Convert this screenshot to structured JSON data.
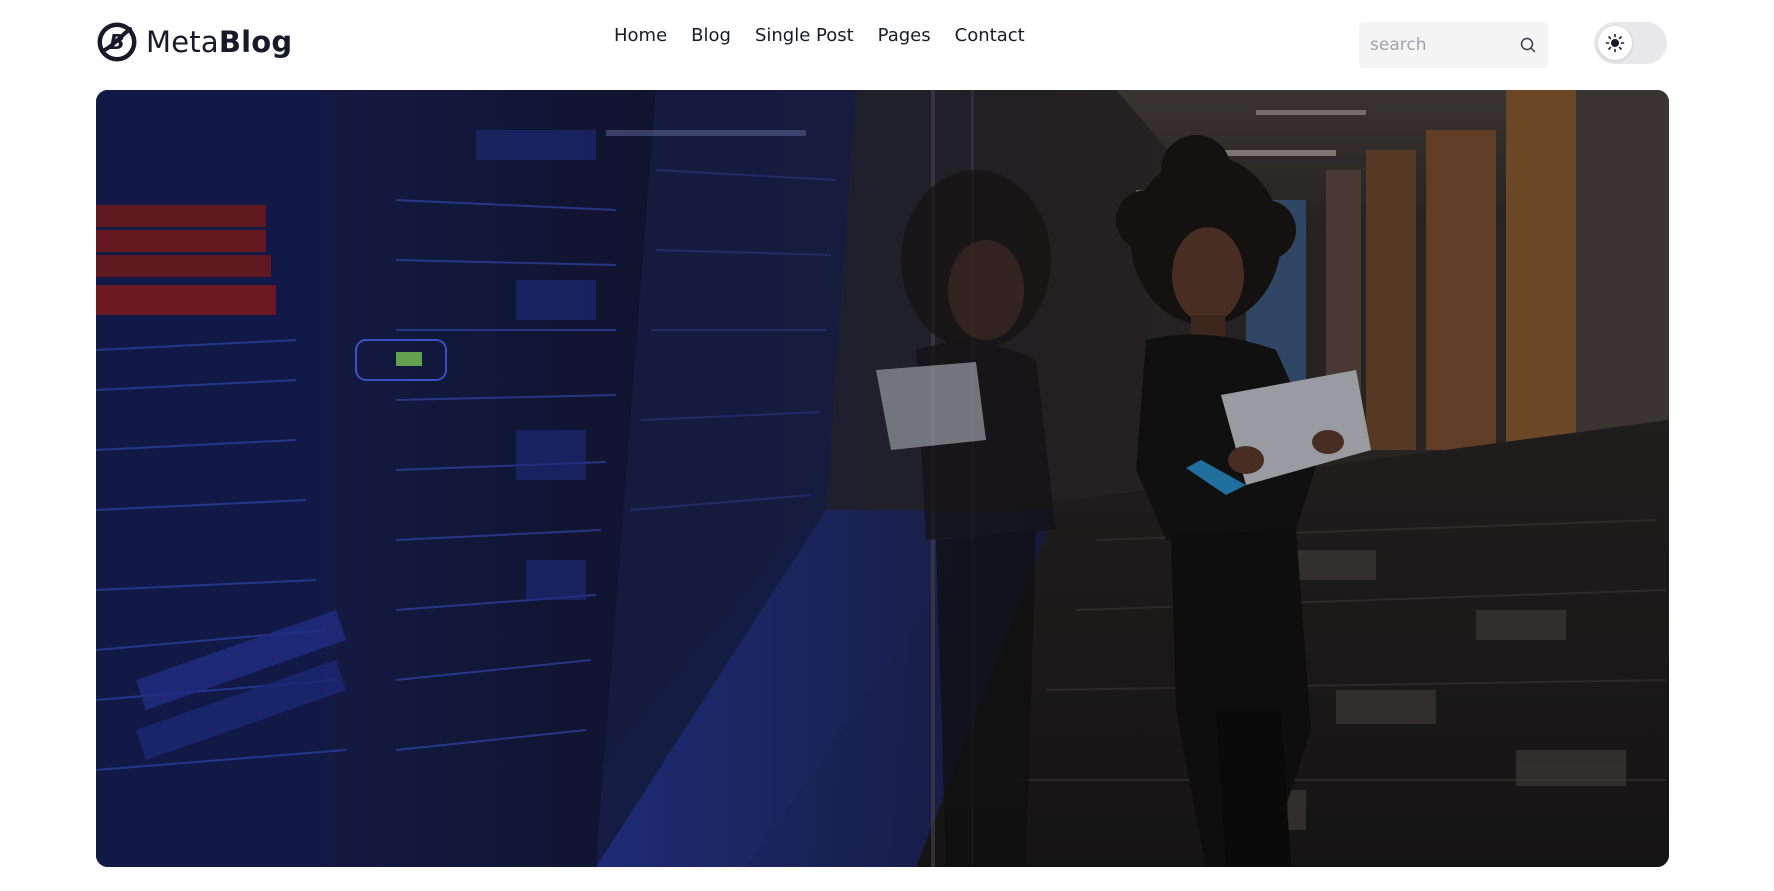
{
  "brand": {
    "name_light": "Meta",
    "name_bold": "Blog"
  },
  "nav": {
    "items": [
      {
        "label": "Home"
      },
      {
        "label": "Blog"
      },
      {
        "label": "Single Post"
      },
      {
        "label": "Pages"
      },
      {
        "label": "Contact"
      }
    ]
  },
  "search": {
    "placeholder": "search",
    "value": ""
  },
  "theme_toggle": {
    "mode": "light",
    "icon": "sun-icon"
  },
  "hero": {
    "image": "photo: woman holding a laptop leaning on a glass wall beside server racks"
  },
  "icons": {
    "search": "search-icon",
    "theme": "sun-icon"
  },
  "colors": {
    "text": "#181a2a",
    "search_bg": "#f4f4f5",
    "toggle_bg": "#e8e8ea",
    "accent_blue": "#3b5bff"
  }
}
